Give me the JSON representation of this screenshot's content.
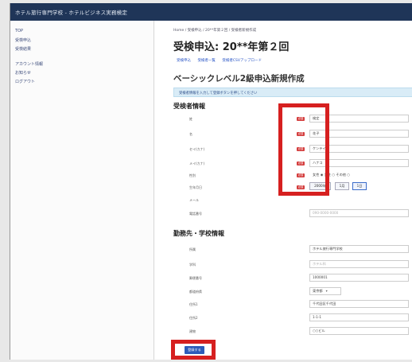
{
  "window": {
    "title": "ホテル旅行専門学校 - ホテルビジネス実務検定"
  },
  "sidebar": {
    "items": [
      {
        "label": "TOP"
      },
      {
        "label": "受検申込"
      },
      {
        "label": "受検結果"
      },
      {
        "label": "アカウント情報"
      },
      {
        "label": "お知らせ"
      },
      {
        "label": "ログアウト"
      }
    ]
  },
  "breadcrumb": "Home / 受検申込 / 20**年第２回 / 受検者新規作成",
  "page": {
    "title": "受検申込: 20**年第２回",
    "tabs": [
      {
        "label": "受検申込"
      },
      {
        "label": "受検者一覧"
      },
      {
        "label": "受検者CSVアップロード"
      }
    ],
    "subtitle": "ベーシックレベル2級申込新規作成",
    "info": "受検者情報を入力して登録ボタンを押してください"
  },
  "examinee": {
    "heading": "受検者情報",
    "fields": [
      {
        "label": "姓",
        "required": "必須",
        "value": "検定"
      },
      {
        "label": "名",
        "required": "必須",
        "value": "花子"
      },
      {
        "label": "セイ(カナ)",
        "required": "必須",
        "value": "ケンテイ"
      },
      {
        "label": "メイ(カナ)",
        "required": "必須",
        "value": "ハナコ"
      },
      {
        "label": "性別",
        "required": "必須",
        "value": "女性 ◉ 男性 ○ その他 ○"
      },
      {
        "label": "生年月日",
        "required": "必須",
        "value": "2000年",
        "dob": [
          "1月",
          "1日"
        ]
      },
      {
        "label": "メール",
        "value": ""
      },
      {
        "label": "電話番号",
        "value": "090-0000-0000"
      }
    ]
  },
  "school": {
    "heading": "勤務先・学校情報",
    "fields": [
      {
        "label": "所属",
        "value": "ホテル旅行専門学校"
      },
      {
        "label": "学科",
        "value": "ホテル科"
      },
      {
        "label": "郵便番号",
        "value": "1000001"
      },
      {
        "label": "都道府県",
        "value": "東京都"
      },
      {
        "label": "住所1",
        "value": "千代田区千代田"
      },
      {
        "label": "住所2",
        "value": "1-1-1"
      },
      {
        "label": "建物",
        "value": "○○ビル"
      }
    ]
  },
  "submit_label": "登録する",
  "colors": {
    "topbar": "#1f3558",
    "highlight": "#d62020",
    "required": "#d43d3d",
    "primary": "#2d5bb8"
  }
}
